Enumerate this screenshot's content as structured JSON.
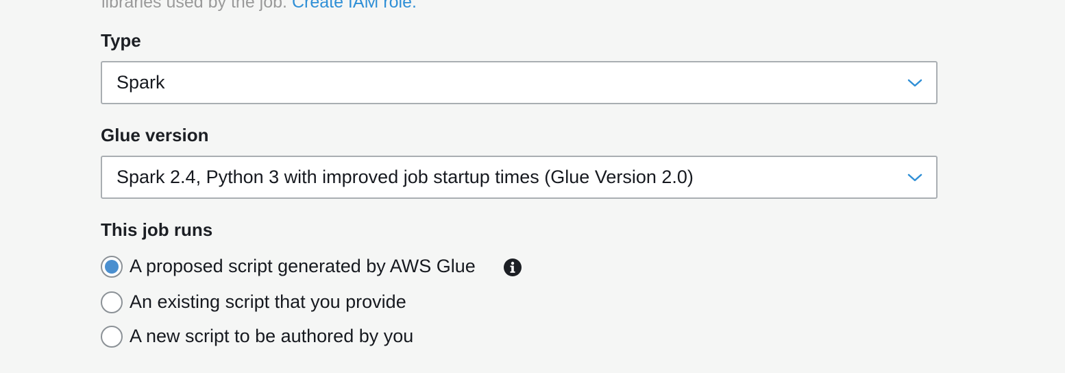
{
  "intro": {
    "text": "libraries used by the job.",
    "link": "Create IAM role."
  },
  "type_field": {
    "label": "Type",
    "value": "Spark"
  },
  "glue_version_field": {
    "label": "Glue version",
    "value": "Spark 2.4, Python 3 with improved job startup times (Glue Version 2.0)"
  },
  "job_runs": {
    "label": "This job runs",
    "options": [
      {
        "label": "A proposed script generated by AWS Glue",
        "selected": true
      },
      {
        "label": "An existing script that you provide",
        "selected": false
      },
      {
        "label": "A new script to be authored by you",
        "selected": false
      }
    ]
  },
  "colors": {
    "accent": "#2f8fd6",
    "radio_selected": "#4a8fcf",
    "background": "#f5f6f5"
  },
  "icons": {
    "select_chevron": "chevron-down-icon",
    "info": "info-icon"
  }
}
